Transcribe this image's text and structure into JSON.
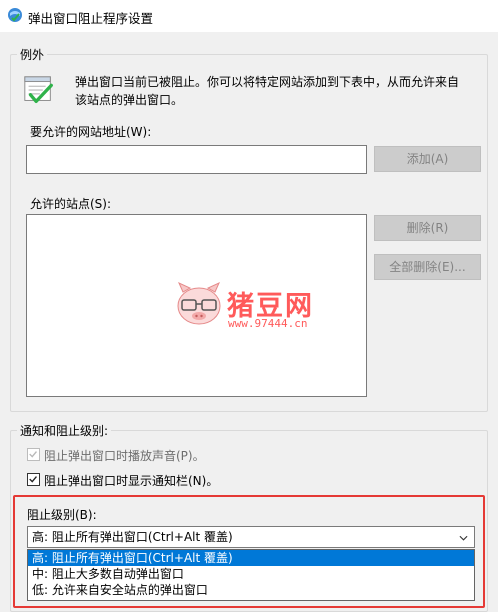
{
  "window": {
    "title": "弹出窗口阻止程序设置"
  },
  "exceptions": {
    "group_label": "例外",
    "description_line1": "弹出窗口当前已被阻止。你可以将特定网站添加到下表中，从而允许来自",
    "description_line2": "该站点的弹出窗口。",
    "address_label": "要允许的网站地址(W):",
    "address_value": "",
    "add_button": "添加(A)",
    "allowed_sites_label": "允许的站点(S):",
    "allowed_sites": [],
    "remove_button": "删除(R)",
    "remove_all_button": "全部删除(E)..."
  },
  "notifications": {
    "group_label": "通知和阻止级别:",
    "play_sound_label": "阻止弹出窗口时播放声音(P)。",
    "play_sound_checked": true,
    "show_bar_label": "阻止弹出窗口时显示通知栏(N)。",
    "show_bar_checked": true,
    "blocking_level_label": "阻止级别(B):",
    "blocking_level_selected": "高: 阻止所有弹出窗口(Ctrl+Alt 覆盖)",
    "blocking_level_options": [
      "高: 阻止所有弹出窗口(Ctrl+Alt 覆盖)",
      "中: 阻止大多数自动弹出窗口",
      "低: 允许来自安全站点的弹出窗口"
    ]
  },
  "watermark": {
    "brand": "猪豆网",
    "url": "www.97444.cn"
  },
  "colors": {
    "highlight": "#0078d7",
    "annotation_border": "#e53935",
    "watermark": "#ff5a5a"
  }
}
